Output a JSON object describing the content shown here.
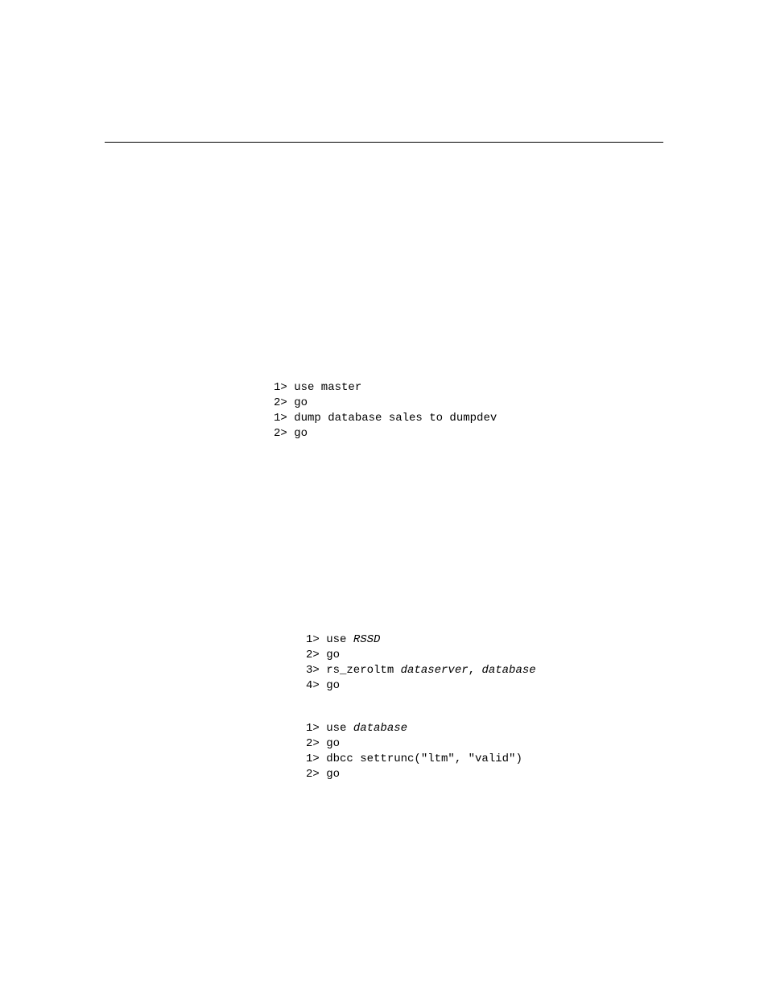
{
  "block1": {
    "l1": "1> use master",
    "l2": "2> go",
    "l3": "1> dump database sales to dumpdev",
    "l4": "2> go"
  },
  "block2": {
    "l1a": "1> use ",
    "l1b_italic": "RSSD",
    "l2": "2> go",
    "l3a": "3> rs_zeroltm ",
    "l3b_italic": "dataserver",
    "l3c": ", ",
    "l3d_italic": "database",
    "l4": "4> go"
  },
  "block3": {
    "l1a": "1> use ",
    "l1b_italic": "database",
    "l2": "2> go",
    "l3": "1> dbcc settrunc(\"ltm\", \"valid\")",
    "l4": "2> go"
  }
}
